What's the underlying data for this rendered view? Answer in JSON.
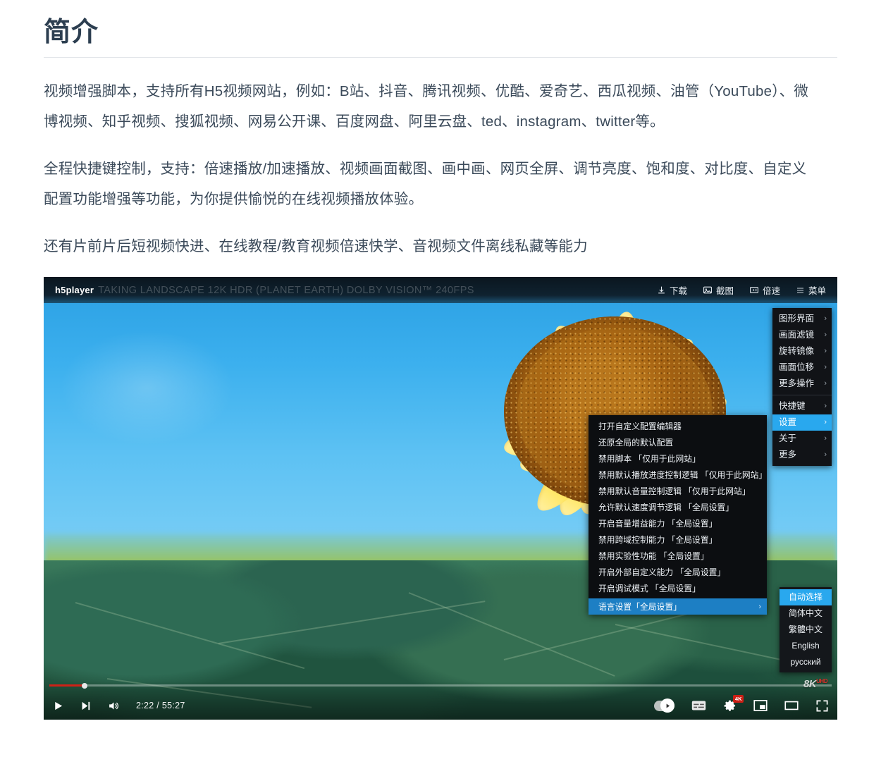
{
  "article": {
    "title": "简介",
    "paragraphs": [
      "视频增强脚本，支持所有H5视频网站，例如：B站、抖音、腾讯视频、优酷、爱奇艺、西瓜视频、油管（YouTube）、微博视频、知乎视频、搜狐视频、网易公开课、百度网盘、阿里云盘、ted、instagram、twitter等。",
      "全程快捷键控制，支持：倍速播放/加速播放、视频画面截图、画中画、网页全屏、调节亮度、饱和度、对比度、自定义配置功能增强等功能，为你提供愉悦的在线视频播放体验。",
      "还有片前片后短视频快进、在线教程/教育视频倍速快学、音视频文件离线私藏等能力"
    ]
  },
  "player": {
    "brand": "h5player",
    "video_title": "TAKING LANDSCAPE 12K HDR (PLANET EARTH) DOLBY VISION™ 240FPS",
    "top_actions": [
      {
        "icon": "download-icon",
        "label": "下载"
      },
      {
        "icon": "screenshot-icon",
        "label": "截图"
      },
      {
        "icon": "speed-icon",
        "label": "倍速"
      },
      {
        "icon": "menu-icon",
        "label": "菜单"
      }
    ],
    "right_menu": {
      "group1": [
        {
          "label": "图形界面",
          "caret": "›"
        },
        {
          "label": "画面滤镜",
          "caret": "›"
        },
        {
          "label": "旋转镜像",
          "caret": "›"
        },
        {
          "label": "画面位移",
          "caret": "›"
        },
        {
          "label": "更多操作",
          "caret": "›"
        }
      ],
      "group2": [
        {
          "label": "快捷键",
          "caret": "›"
        },
        {
          "label": "设置",
          "caret": "›"
        },
        {
          "label": "关于",
          "caret": "›"
        },
        {
          "label": "更多",
          "caret": "›"
        }
      ]
    },
    "settings_menu": {
      "items": [
        "打开自定义配置编辑器",
        "还原全局的默认配置",
        "禁用脚本 「仅用于此网站」",
        "禁用默认播放进度控制逻辑 「仅用于此网站」",
        "禁用默认音量控制逻辑 「仅用于此网站」",
        "允许默认速度调节逻辑 「全局设置」",
        "开启音量增益能力 「全局设置」",
        "禁用跨域控制能力 「全局设置」",
        "禁用实验性功能 「全局设置」",
        "开启外部自定义能力 「全局设置」",
        "开启调试模式 「全局设置」"
      ],
      "language_row": {
        "label": "语言设置「全局设置」",
        "caret": "›"
      }
    },
    "language_menu": {
      "options": [
        "自动选择",
        "简体中文",
        "繁體中文",
        "English",
        "русский"
      ],
      "selected": "自动选择"
    },
    "watermark": {
      "text": "8K",
      "sub": "UHD"
    },
    "controls": {
      "time": "2:22 / 55:27",
      "progress_percent": 4.5,
      "play_icon": "play-icon",
      "next_icon": "next-track-icon",
      "volume_icon": "volume-icon",
      "autoplay_icon": "autoplay-toggle-icon",
      "subtitles_icon": "subtitles-icon",
      "settings_icon": "gear-icon",
      "settings_badge": "4K",
      "miniplayer_icon": "miniplayer-icon",
      "theater_icon": "theater-mode-icon",
      "fullscreen_icon": "fullscreen-icon"
    }
  },
  "colors": {
    "heading": "#2c3e50",
    "body_text": "#3b4a5a",
    "accent_blue": "#29a8ee",
    "progress_red": "#cf2117",
    "badge_red": "#cc1f15"
  }
}
